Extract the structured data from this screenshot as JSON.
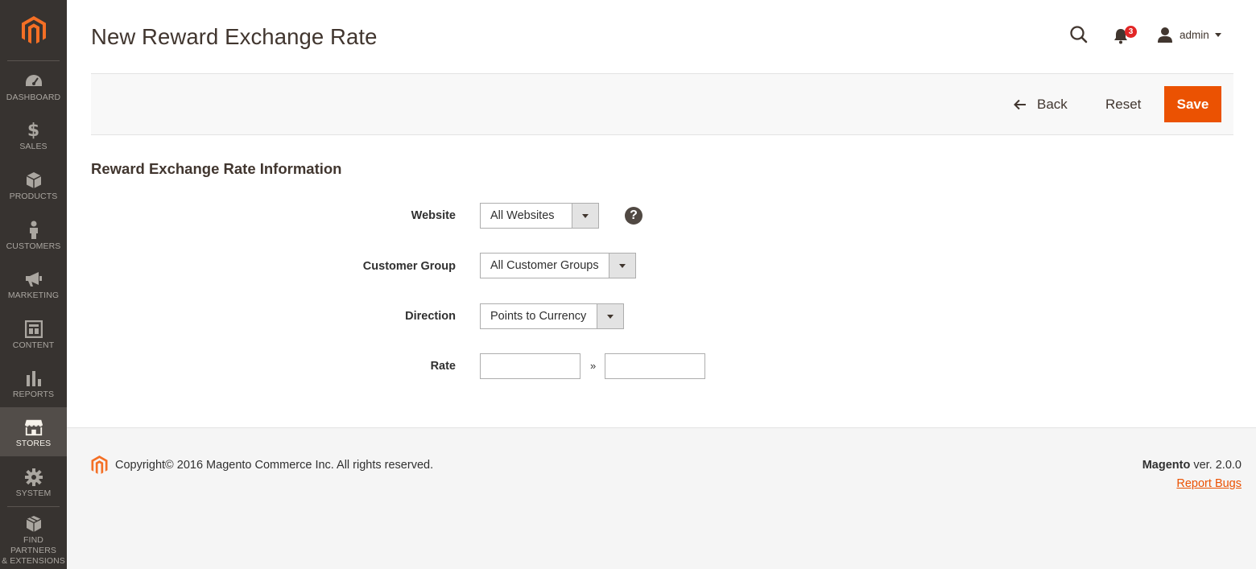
{
  "sidebar": {
    "items": [
      {
        "label": "DASHBOARD",
        "icon": "dashboard-icon"
      },
      {
        "label": "SALES",
        "icon": "dollar-icon"
      },
      {
        "label": "PRODUCTS",
        "icon": "box-icon"
      },
      {
        "label": "CUSTOMERS",
        "icon": "person-icon"
      },
      {
        "label": "MARKETING",
        "icon": "megaphone-icon"
      },
      {
        "label": "CONTENT",
        "icon": "layout-icon"
      },
      {
        "label": "REPORTS",
        "icon": "bar-chart-icon"
      },
      {
        "label": "STORES",
        "icon": "storefront-icon",
        "active": true
      },
      {
        "label": "SYSTEM",
        "icon": "gear-icon"
      },
      {
        "label_line1": "FIND PARTNERS",
        "label_line2": "& EXTENSIONS",
        "icon": "blocks-icon"
      }
    ]
  },
  "header": {
    "title": "New Reward Exchange Rate",
    "notification_count": "3",
    "username": "admin"
  },
  "actions": {
    "back_label": "Back",
    "reset_label": "Reset",
    "save_label": "Save"
  },
  "form": {
    "section_title": "Reward Exchange Rate Information",
    "website": {
      "label": "Website",
      "value": "All Websites"
    },
    "customer_group": {
      "label": "Customer Group",
      "value": "All Customer Groups"
    },
    "direction": {
      "label": "Direction",
      "value": "Points to Currency"
    },
    "rate": {
      "label": "Rate",
      "separator": "»",
      "from_value": "",
      "to_value": ""
    },
    "help_glyph": "?"
  },
  "footer": {
    "copyright": "Copyright© 2016 Magento Commerce Inc. All rights reserved.",
    "brand": "Magento",
    "version": " ver. 2.0.0",
    "report_bugs": "Report Bugs"
  },
  "colors": {
    "sidebar_bg": "#373330",
    "accent": "#eb5202",
    "logo": "#f46f25"
  }
}
